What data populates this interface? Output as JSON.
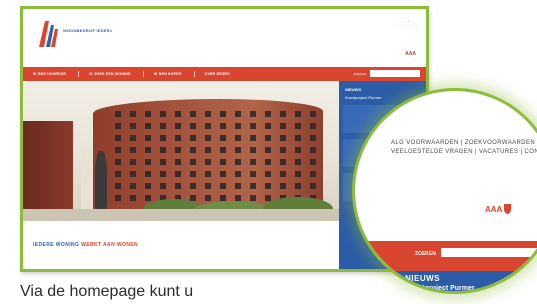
{
  "screenshot": {
    "logo_text": "WOONBEDRIJF IEDER1",
    "top_links": [
      "··· ········ | ········",
      "···· ··· ···· ········",
      "········ ··· ····"
    ],
    "size_tools": "AAA",
    "nav": {
      "items": [
        "IK BEN HUURDER",
        "IK ZOEK EEN WONING",
        "IK BEN KOPER",
        "OVER IEDER1"
      ],
      "search_label": "ZOEKEN"
    },
    "slogan": {
      "part1": "IEDERE WONING",
      "part2": " WERKT AAN WONEN"
    },
    "sidebar": {
      "blocks": [
        "NIEUWS",
        "Kunstproject Purmer"
      ]
    }
  },
  "magnifier": {
    "links": [
      "ALG VOORWAARDEN | ZOEKVOORWAARDEN",
      "VEELGESTELDE VRAGEN | VACATURES | CONTACT"
    ],
    "size_tools": "AAA",
    "search_label": "ZOEKEN",
    "news_title": "NIEUWS",
    "news_item": "Kunstproject Purmer"
  },
  "caption": "Via de homepage kunt u",
  "colors": {
    "accent_red": "#d9452f",
    "brand_blue": "#2c5ca8",
    "frame_green": "#8dbb3a"
  }
}
